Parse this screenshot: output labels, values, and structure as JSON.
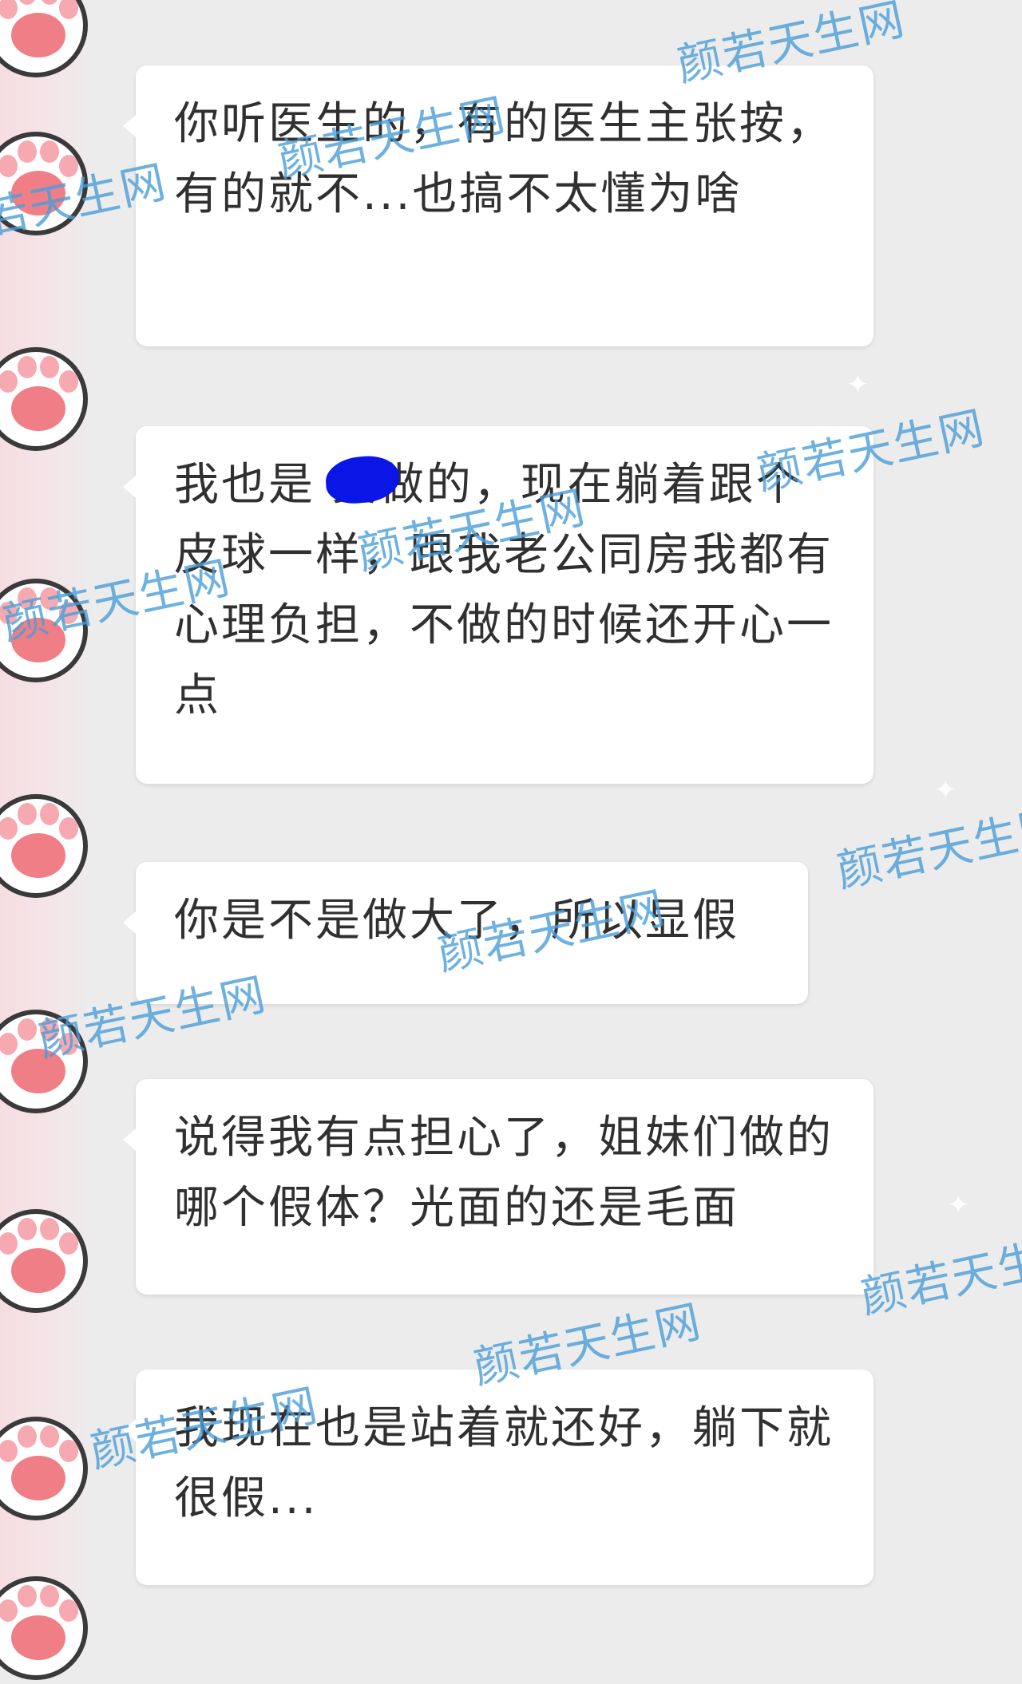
{
  "messages": [
    {
      "text": "你听医生的，有的医生主张按，有的就不...也搞不太懂为啥"
    },
    {
      "text": "我也是  美做的，现在躺着跟个皮球一样，跟我老公同房我都有心理负担，不做的时候还开心一点"
    },
    {
      "text": "你是不是做大了，所以显假"
    },
    {
      "text": "说得我有点担心了，姐妹们做的哪个假体？光面的还是毛面"
    },
    {
      "text": "我现在也是站着就还好，躺下就很假..."
    }
  ],
  "watermark": {
    "text": "颜若天生网",
    "color": "#4a9ed8"
  },
  "avatar": {
    "icon": "paw-icon",
    "pad_color": "#f07e86",
    "toe_color": "#f6a9b0"
  },
  "redaction_color": "#0a16e6",
  "bubble_color": "#ffffff",
  "background_color": "#ececec"
}
